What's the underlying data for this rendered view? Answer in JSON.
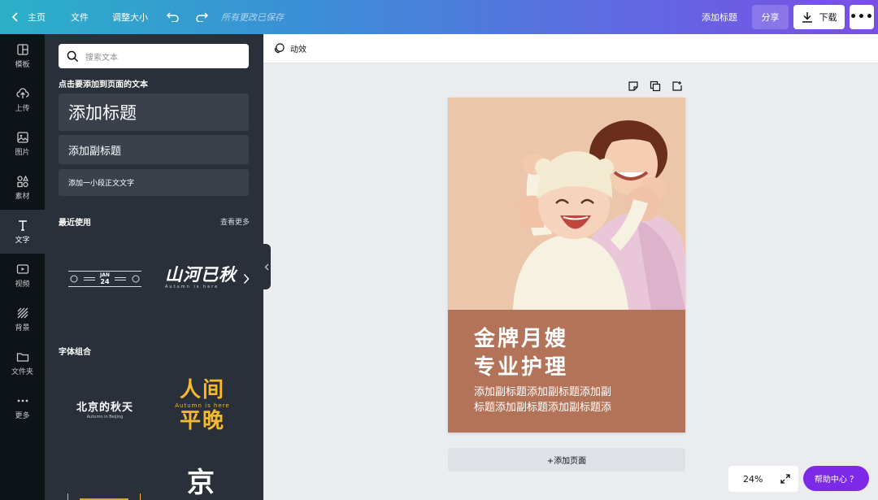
{
  "topbar": {
    "home_label": "主页",
    "file_label": "文件",
    "resize_label": "调整大小",
    "saved_status": "所有更改已保存",
    "add_title_label": "添加标题",
    "share_label": "分享",
    "download_label": "下载",
    "more_label": "•••"
  },
  "rail": {
    "items": [
      {
        "label": "模板",
        "icon": "layout-icon"
      },
      {
        "label": "上传",
        "icon": "upload-icon"
      },
      {
        "label": "图片",
        "icon": "image-icon"
      },
      {
        "label": "素材",
        "icon": "elements-icon"
      },
      {
        "label": "文字",
        "icon": "text-icon"
      },
      {
        "label": "视频",
        "icon": "video-icon"
      },
      {
        "label": "背景",
        "icon": "background-icon"
      },
      {
        "label": "文件夹",
        "icon": "folder-icon"
      },
      {
        "label": "更多",
        "icon": "more-icon"
      }
    ],
    "active_index": 4
  },
  "panel": {
    "search_placeholder": "搜索文本",
    "click_to_add_label": "点击要添加到页面的文本",
    "add_heading": "添加标题",
    "add_subheading": "添加副标题",
    "add_body": "添加一小段正文文字",
    "recent_label": "最近使用",
    "see_more": "查看更多",
    "font_combos_label": "字体组合",
    "recent_template_1_month": "JAN",
    "recent_template_1_day": "24",
    "recent_template_2_title": "山河已秋",
    "recent_template_2_sub": "Autumn is here",
    "combo_1_title": "北京的秋天",
    "combo_1_sub": "Autumn in Beijing",
    "combo_2_line1": "人间",
    "combo_2_sub": "Autumn is here",
    "combo_2_line2": "平晚",
    "combo_3_title": "京"
  },
  "workspace": {
    "animate_label": "动效",
    "headline_line1": "金牌月嫂",
    "headline_line2": "专业护理",
    "subline_1": "添加副标题添加副标题添加副",
    "subline_2": "标题添加副标题添加副标题添",
    "add_page_label": "+添加页面",
    "zoom": "24%",
    "help_label": "帮助中心 ？"
  },
  "colors": {
    "accent": "#7d2ae8",
    "page_bg": "#ecc6aa",
    "caption_band": "#b27358",
    "panel_bg": "#293039",
    "rail_bg": "#0e1318",
    "combo_gold": "#f5b82e"
  }
}
